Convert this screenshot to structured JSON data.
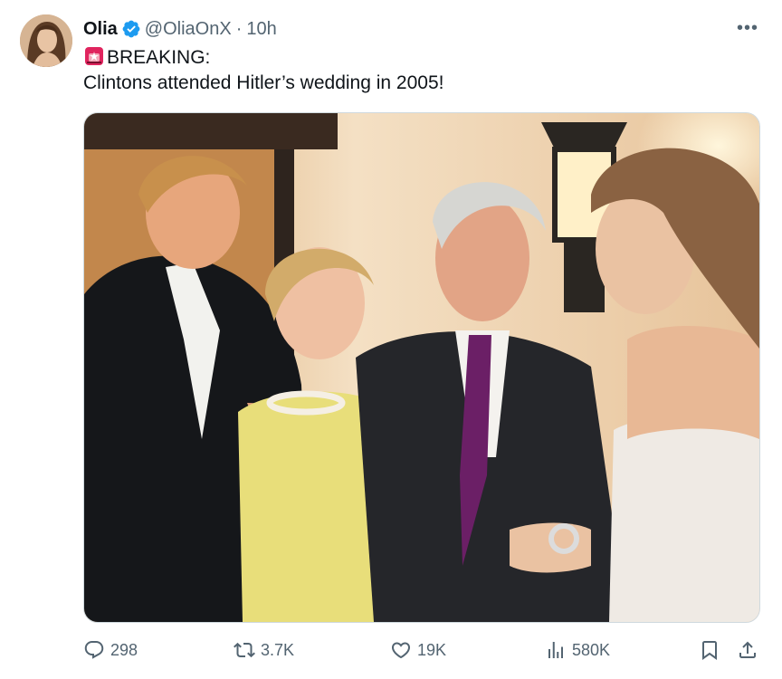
{
  "tweet": {
    "author_name": "Olia",
    "handle": "@OliaOnX",
    "separator": "·",
    "time": "10h",
    "more_label": "•••",
    "headline": "BREAKING:",
    "body": "Clintons attended Hitler’s wedding in 2005!",
    "headline_icon": "siren-icon",
    "verified_icon": "verified-badge-icon"
  },
  "stats": {
    "replies": "298",
    "reposts": "3.7K",
    "likes": "19K",
    "views": "580K"
  },
  "colors": {
    "text": "#0f1419",
    "secondary": "#536471",
    "verified": "#1d9bf0",
    "siren": "#e0245e"
  }
}
